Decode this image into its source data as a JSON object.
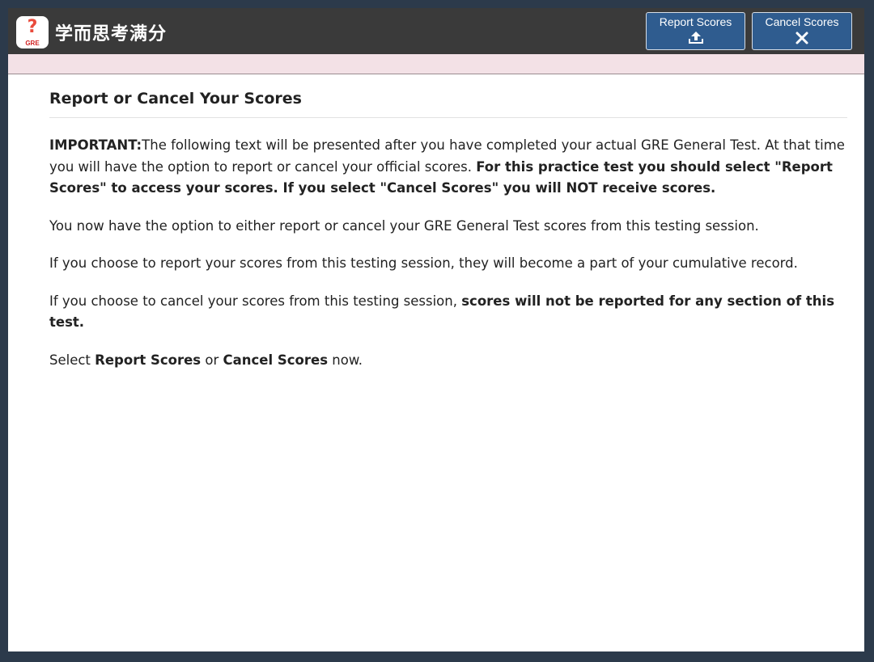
{
  "header": {
    "logo_glyph": "?",
    "logo_sub": "GRE",
    "brand": "学而思考满分",
    "report_button": "Report Scores",
    "cancel_button": "Cancel Scores"
  },
  "main": {
    "heading": "Report or Cancel Your Scores",
    "p1": {
      "lead": "IMPORTANT:",
      "text": "The following text will be presented after you have completed your actual GRE General Test. At that time you will have the option to report or cancel your official scores. ",
      "bold": "For this practice test you should select \"Report Scores\" to access your scores. If you select \"Cancel Scores\" you will NOT receive scores."
    },
    "p2": "You now have the option to either report or cancel your GRE General Test scores from this testing session.",
    "p3": "If you choose to report your scores from this testing session, they will become a part of your cumulative record.",
    "p4": {
      "text": "If you choose to cancel your scores from this testing session, ",
      "bold": "scores will not be reported for any section of this test."
    },
    "p5": {
      "pre": "Select ",
      "b1": "Report Scores",
      "mid": " or ",
      "b2": "Cancel Scores",
      "post": " now."
    }
  },
  "colors": {
    "topbar": "#3a3a3a",
    "button": "#2f5c8f",
    "pinkbar": "#f3e1e6",
    "backdrop": "#2c3a4b"
  },
  "icons": {
    "report": "upload-tray-icon",
    "cancel": "close-x-icon"
  }
}
